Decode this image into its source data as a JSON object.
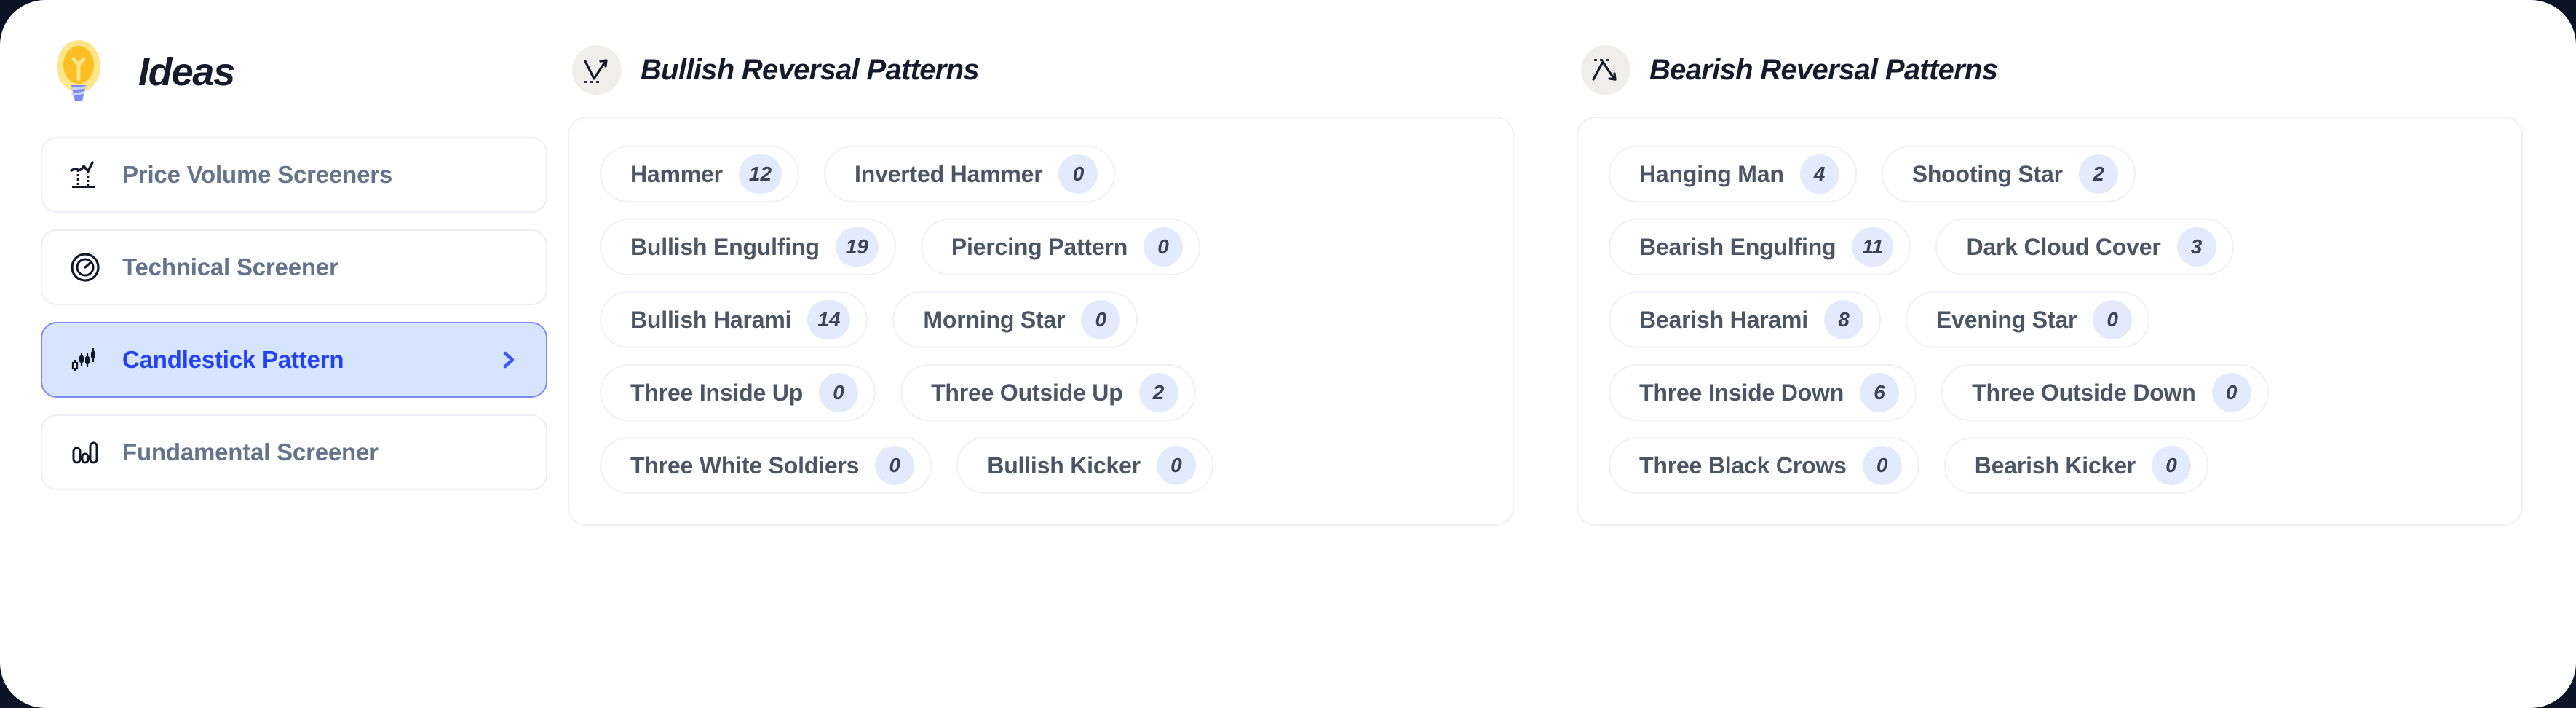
{
  "brand": {
    "title": "Ideas",
    "logo_icon": "lightbulb-icon"
  },
  "sidebar": {
    "items": [
      {
        "label": "Price Volume Screeners",
        "icon": "price-volume-chart-icon",
        "active": false
      },
      {
        "label": "Technical Screener",
        "icon": "gauge-icon",
        "active": false
      },
      {
        "label": "Candlestick Pattern",
        "icon": "candlestick-icon",
        "active": true,
        "chevron_icon": "chevron-right-icon"
      },
      {
        "label": "Fundamental Screener",
        "icon": "bar-chart-icon",
        "active": false
      }
    ]
  },
  "columns": [
    {
      "title": "Bullish Reversal Patterns",
      "icon": "trend-up-reversal-icon",
      "rows": [
        [
          {
            "label": "Hammer",
            "count": "12"
          },
          {
            "label": "Inverted Hammer",
            "count": "0"
          }
        ],
        [
          {
            "label": "Bullish Engulfing",
            "count": "19"
          },
          {
            "label": "Piercing Pattern",
            "count": "0"
          }
        ],
        [
          {
            "label": "Bullish Harami",
            "count": "14"
          },
          {
            "label": "Morning Star",
            "count": "0"
          }
        ],
        [
          {
            "label": "Three Inside Up",
            "count": "0"
          },
          {
            "label": "Three Outside Up",
            "count": "2"
          }
        ],
        [
          {
            "label": "Three White Soldiers",
            "count": "0"
          },
          {
            "label": "Bullish Kicker",
            "count": "0"
          }
        ]
      ]
    },
    {
      "title": "Bearish Reversal Patterns",
      "icon": "trend-down-reversal-icon",
      "rows": [
        [
          {
            "label": "Hanging Man",
            "count": "4"
          },
          {
            "label": "Shooting Star",
            "count": "2"
          }
        ],
        [
          {
            "label": "Bearish Engulfing",
            "count": "11"
          },
          {
            "label": "Dark Cloud Cover",
            "count": "3"
          }
        ],
        [
          {
            "label": "Bearish Harami",
            "count": "8"
          },
          {
            "label": "Evening Star",
            "count": "0"
          }
        ],
        [
          {
            "label": "Three Inside Down",
            "count": "6"
          },
          {
            "label": "Three Outside Down",
            "count": "0"
          }
        ],
        [
          {
            "label": "Three Black Crows",
            "count": "0"
          },
          {
            "label": "Bearish Kicker",
            "count": "0"
          }
        ]
      ]
    }
  ],
  "colors": {
    "accent": "#2442f2",
    "active_bg": "#d7e4fd",
    "active_border": "#7d8cf5",
    "badge_bg": "#e2eafc",
    "label": "#64748b",
    "title": "#151b2c",
    "page_backdrop": "#0d1326"
  }
}
